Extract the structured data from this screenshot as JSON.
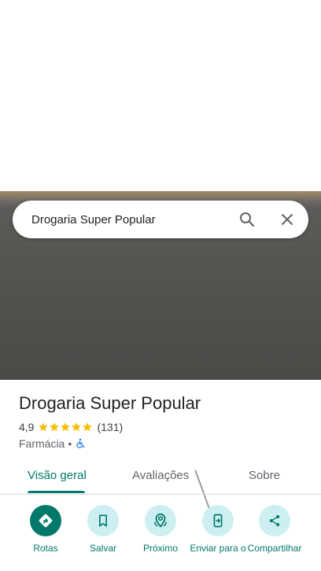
{
  "search": {
    "query": "Drogaria Super Popular"
  },
  "place": {
    "name": "Drogaria Super Popular",
    "rating": "4,9",
    "stars": 5,
    "review_count": "(131)",
    "category": "Farmácia",
    "separator": "•"
  },
  "tabs": [
    {
      "label": "Visão geral",
      "active": true
    },
    {
      "label": "Avaliações",
      "active": false
    },
    {
      "label": "Sobre",
      "active": false
    }
  ],
  "actions": [
    {
      "label": "Rotas",
      "icon": "directions-icon"
    },
    {
      "label": "Salvar",
      "icon": "bookmark-icon"
    },
    {
      "label": "Próximo",
      "icon": "nearby-icon"
    },
    {
      "label": "Enviar para o",
      "icon": "send-to-phone-icon"
    },
    {
      "label": "Compartilhar",
      "icon": "share-icon"
    }
  ],
  "colors": {
    "accent": "#00796b",
    "action_bg": "#cdeff2",
    "star": "#fbbc04",
    "accessibility": "#1a73e8"
  }
}
